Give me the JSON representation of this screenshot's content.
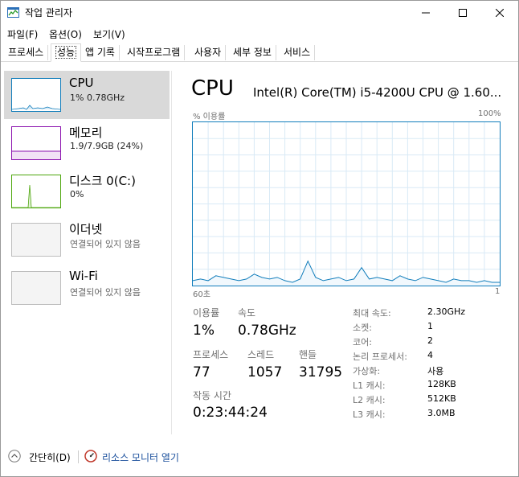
{
  "window": {
    "title": "작업 관리자",
    "icon": "task-manager-icon"
  },
  "menu": [
    "파일(F)",
    "옵션(O)",
    "보기(V)"
  ],
  "tabs": [
    "프로세스",
    "성능",
    "앱 기록",
    "시작프로그램",
    "사용자",
    "세부 정보",
    "서비스"
  ],
  "active_tab": "성능",
  "sidebar": [
    {
      "name": "CPU",
      "value": "1% 0.78GHz",
      "color": "#117dbb",
      "selected": true
    },
    {
      "name": "메모리",
      "value": "1.9/7.9GB (24%)",
      "color": "#8b12ae",
      "selected": false
    },
    {
      "name": "디스크 0(C:)",
      "value": "0%",
      "color": "#4da60c",
      "selected": false
    },
    {
      "name": "이더넷",
      "value": "연결되어 있지 않음",
      "color": "#a0a0a0",
      "selected": false
    },
    {
      "name": "Wi-Fi",
      "value": "연결되어 있지 않음",
      "color": "#a0a0a0",
      "selected": false
    }
  ],
  "main": {
    "title": "CPU",
    "model": "Intel(R) Core(TM) i5-4200U CPU @ 1.60...",
    "graph_label": "% 이용률",
    "graph_max": "100%",
    "time_left": "60초",
    "time_right": "1",
    "graph_color": "#117dbb",
    "utilization_series": [
      3,
      4,
      3,
      6,
      5,
      4,
      3,
      4,
      7,
      5,
      4,
      5,
      3,
      2,
      4,
      15,
      5,
      3,
      4,
      5,
      3,
      4,
      11,
      4,
      5,
      4,
      3,
      6,
      4,
      3,
      5,
      4,
      3,
      2,
      4,
      3,
      3,
      2,
      3,
      2,
      2
    ]
  },
  "stats": {
    "utilization_label": "이용률",
    "utilization": "1%",
    "speed_label": "속도",
    "speed": "0.78GHz",
    "processes_label": "프로세스",
    "processes": "77",
    "threads_label": "스레드",
    "threads": "1057",
    "handles_label": "핸들",
    "handles": "31795",
    "uptime_label": "작동 시간",
    "uptime": "0:23:44:24"
  },
  "details": [
    {
      "key": "최대 속도:",
      "value": "2.30GHz"
    },
    {
      "key": "소켓:",
      "value": "1"
    },
    {
      "key": "코어:",
      "value": "2"
    },
    {
      "key": "논리 프로세서:",
      "value": "4"
    },
    {
      "key": "가상화:",
      "value": "사용"
    },
    {
      "key": "L1 캐시:",
      "value": "128KB"
    },
    {
      "key": "L2 캐시:",
      "value": "512KB"
    },
    {
      "key": "L3 캐시:",
      "value": "3.0MB"
    }
  ],
  "footer": {
    "collapse": "간단히(D)",
    "resmon": "리소스 모니터 열기"
  }
}
